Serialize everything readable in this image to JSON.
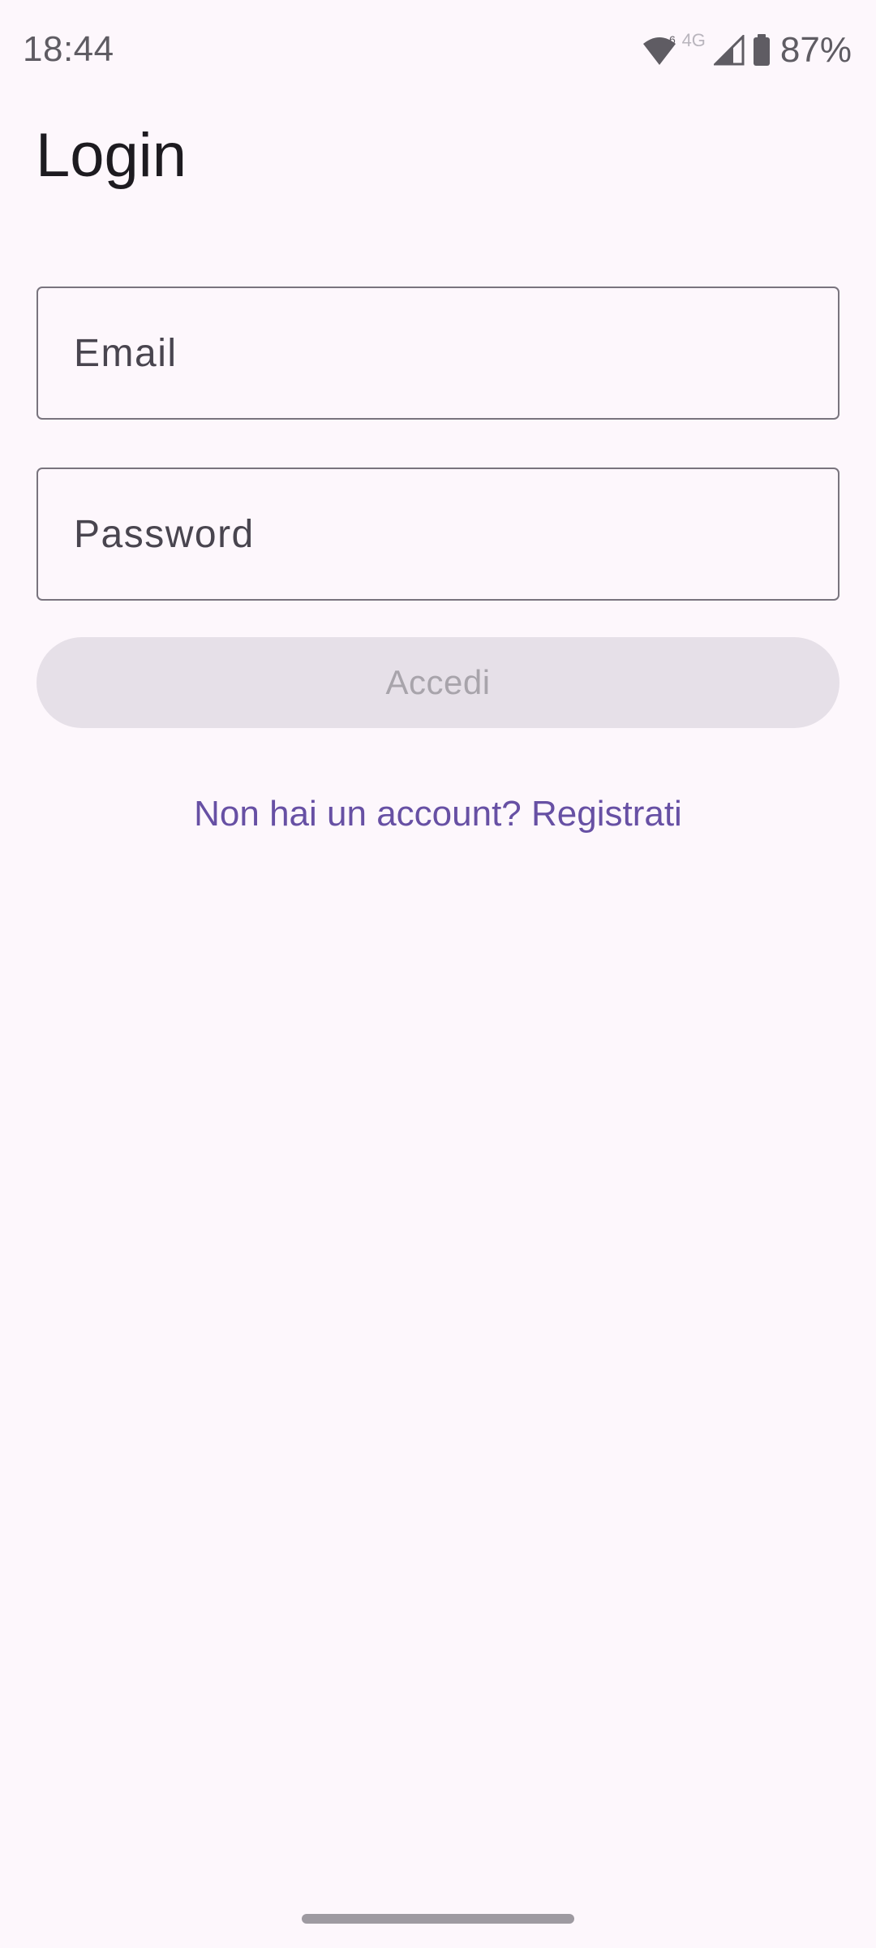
{
  "status_bar": {
    "time": "18:44",
    "network_type": "4G",
    "battery_percent": "87%",
    "icons": [
      "wifi-icon",
      "cellular-signal-icon",
      "battery-icon"
    ]
  },
  "page": {
    "title": "Login"
  },
  "form": {
    "email_label": "Email",
    "password_label": "Password",
    "submit_label": "Accedi",
    "submit_enabled": false,
    "register_link": "Non hai un account? Registrati"
  },
  "colors": {
    "background": "#FDF7FC",
    "primary": "#6750A4",
    "outline": "#79747E",
    "disabled_button": "#E6E0E8"
  }
}
